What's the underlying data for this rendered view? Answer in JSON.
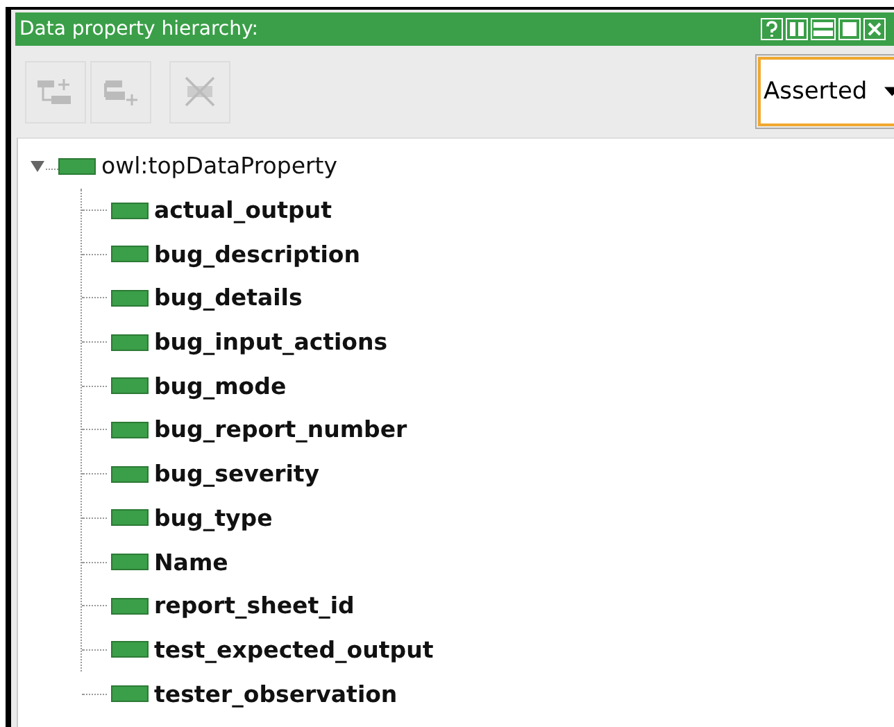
{
  "panel": {
    "title": "Data property hierarchy:"
  },
  "toolbar": {
    "buttons": [
      {
        "kind": "add-sub",
        "disabled": true
      },
      {
        "kind": "add-sibling",
        "disabled": true
      },
      {
        "kind": "delete",
        "disabled": true
      }
    ],
    "view_select": {
      "value": "Asserted"
    }
  },
  "tree": {
    "label": "owl:topDataProperty",
    "expanded": true,
    "children": [
      {
        "label": "actual_output"
      },
      {
        "label": "bug_description"
      },
      {
        "label": "bug_details"
      },
      {
        "label": "bug_input_actions"
      },
      {
        "label": "bug_mode"
      },
      {
        "label": "bug_report_number"
      },
      {
        "label": "bug_severity"
      },
      {
        "label": "bug_type"
      },
      {
        "label": "Name"
      },
      {
        "label": "report_sheet_id"
      },
      {
        "label": "test_expected_output"
      },
      {
        "label": "tester_observation"
      }
    ]
  }
}
